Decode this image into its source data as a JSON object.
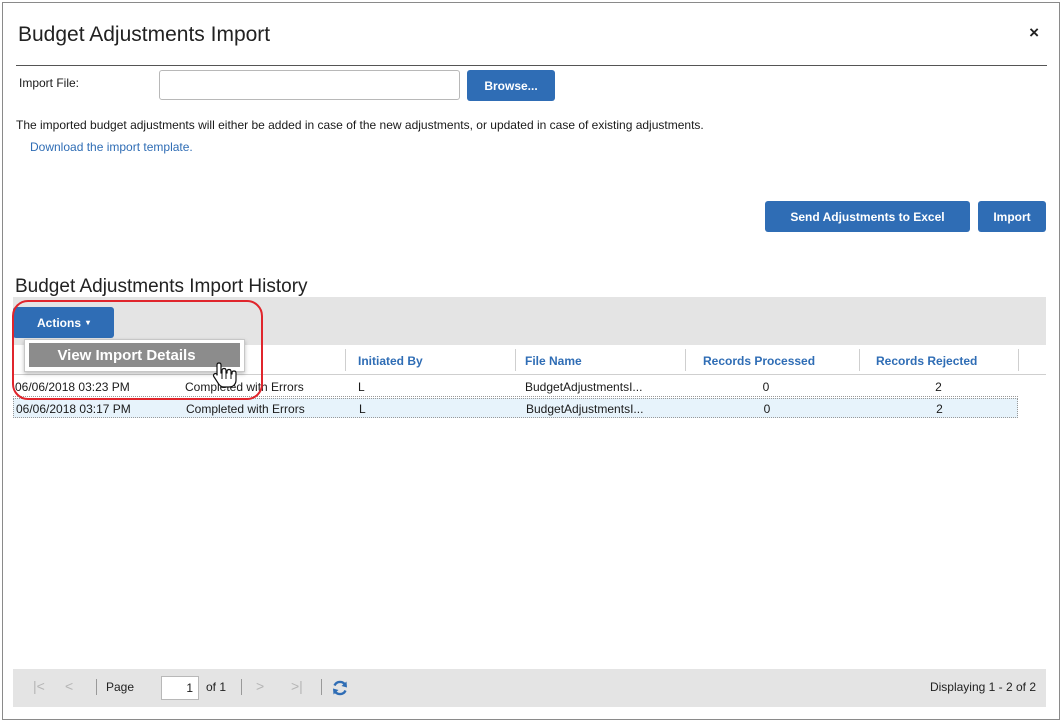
{
  "dialog": {
    "title": "Budget Adjustments Import",
    "close_symbol": "×"
  },
  "import_form": {
    "file_label": "Import File:",
    "file_value": "",
    "browse_label": "Browse...",
    "info_text": "The imported budget adjustments will either be added in case of the new adjustments, or updated in case of existing adjustments.",
    "template_link": "Download the import template.",
    "send_to_excel_label": "Send Adjustments to Excel",
    "import_label": "Import"
  },
  "history": {
    "title": "Budget Adjustments Import History",
    "actions_label": "Actions",
    "actions_arrow": "▾",
    "menu_items": [
      "View Import Details"
    ],
    "columns": [
      "",
      "",
      "Initiated By",
      "File Name",
      "Records Processed",
      "Records Rejected"
    ],
    "rows": [
      {
        "date": "06/06/2018 03:23 PM",
        "status": "Completed with Errors",
        "initiated_by": "L",
        "file_name": "BudgetAdjustmentsI...",
        "processed": "0",
        "rejected": "2"
      },
      {
        "date": "06/06/2018 03:17 PM",
        "status": "Completed with Errors",
        "initiated_by": "L",
        "file_name": "BudgetAdjustmentsI...",
        "processed": "0",
        "rejected": "2"
      }
    ]
  },
  "pager": {
    "first_icon": "first-page-icon",
    "prev_icon": "prev-page-icon",
    "next_icon": "next-page-icon",
    "last_icon": "last-page-icon",
    "refresh_icon": "refresh-icon",
    "page_label": "Page",
    "page_value": "1",
    "of_label": "of 1",
    "display_text": "Displaying 1 - 2 of 2"
  },
  "colors": {
    "accent": "#2f6db5",
    "highlight": "#e0252c",
    "toolbar_bg": "#e4e4e4",
    "selected_row": "#e7f3fb"
  }
}
